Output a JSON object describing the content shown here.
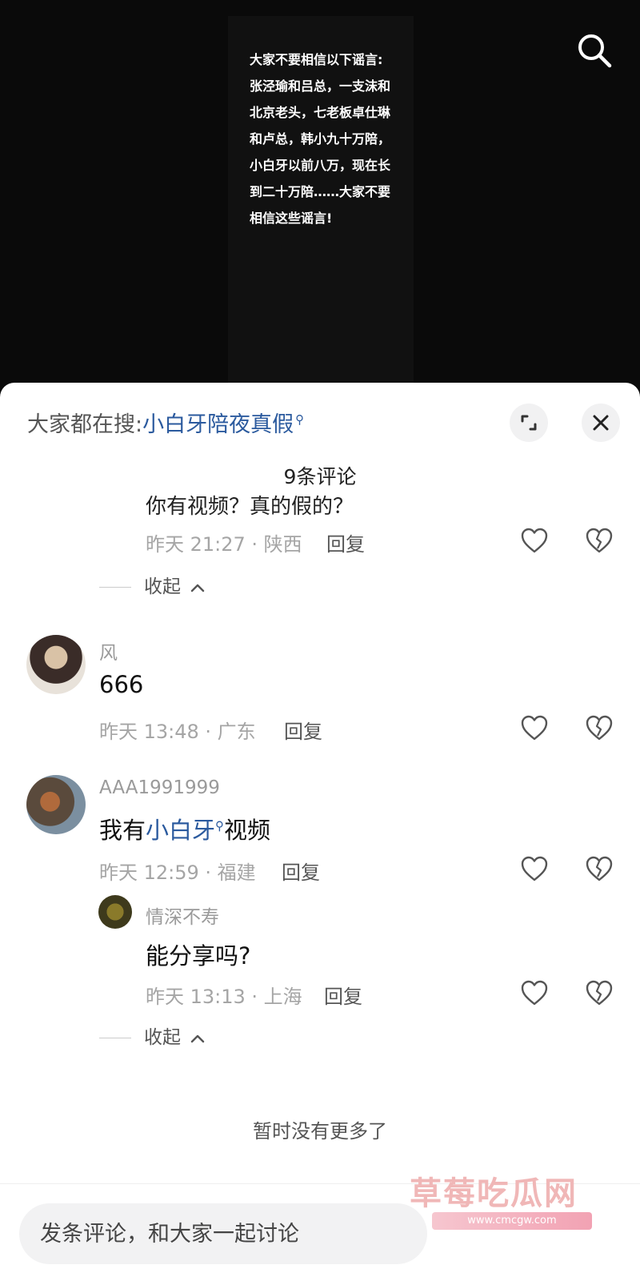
{
  "video": {
    "caption": "大家不要相信以下谣言:张泾瑜和吕总，一支沫和北京老头，七老板卓仕琳和卢总，韩小九十万陪，小白牙以前八万，现在长到二十万陪……大家不要相信这些谣言!"
  },
  "sheet": {
    "hot_search_prefix": "大家都在搜:",
    "hot_search_keyword": "小白牙陪夜真假",
    "count_label": "9条评论"
  },
  "comments": {
    "truncated_text": "你有视频？真的假的？",
    "c0": {
      "meta": "昨天 21:27 · 陕西",
      "reply": "回复",
      "collapse": "收起"
    },
    "c1": {
      "username": "风",
      "text": "666",
      "meta": "昨天 13:48 · 广东",
      "reply": "回复"
    },
    "c2": {
      "username": "AAA1991999",
      "text_prefix": "我有",
      "text_keyword": "小白牙",
      "text_suffix": "视频",
      "meta": "昨天 12:59 · 福建",
      "reply": "回复"
    },
    "c3": {
      "username": "情深不寿",
      "text": "能分享吗?",
      "meta": "昨天 13:13 · 上海",
      "reply": "回复",
      "collapse": "收起"
    },
    "no_more": "暂时没有更多了"
  },
  "input": {
    "placeholder": "发条评论，和大家一起讨论"
  },
  "watermark": {
    "title": "草莓吃瓜网",
    "url": "www.cmcgw.com"
  },
  "icons": {
    "search": "search-icon",
    "expand": "expand-icon",
    "close": "close-icon",
    "like": "heart-icon",
    "dislike": "broken-heart-icon",
    "collapse": "chevron-up-icon",
    "keyword_search": "mini-search-icon"
  },
  "colors": {
    "keyword": "#2b5a9e",
    "meta": "#a5a5a5",
    "sheet_bg": "#ffffff",
    "video_bg": "#0a0a0a"
  }
}
